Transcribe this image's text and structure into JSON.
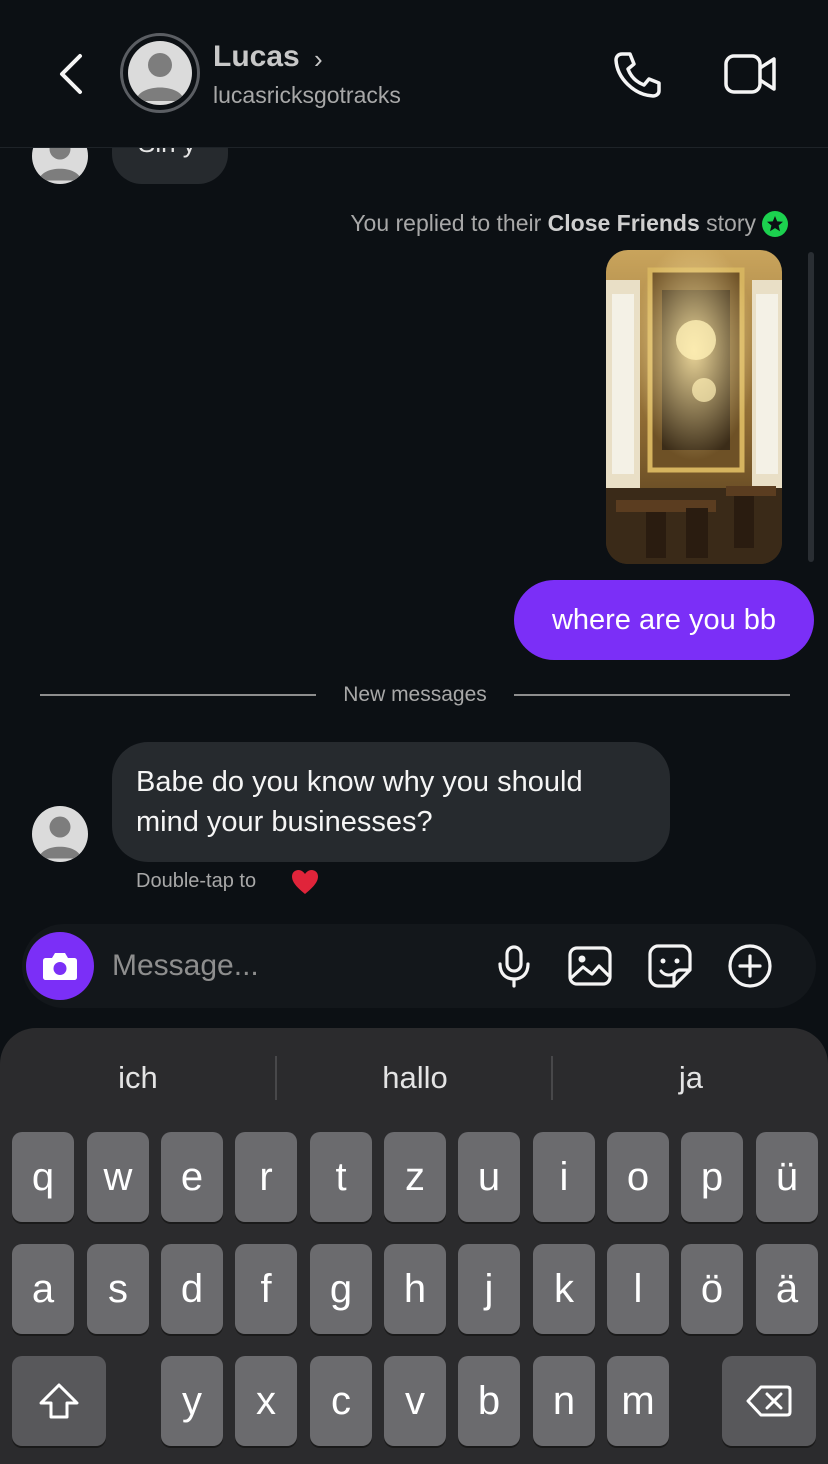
{
  "header": {
    "name": "Lucas",
    "username": "lucasricksgotracks",
    "chevron": "›"
  },
  "chat": {
    "partial_message": "Sin y",
    "story_note_prefix": "You replied to their ",
    "story_note_bold": "Close Friends",
    "story_note_suffix": " story",
    "sent_message": "where are you bb",
    "divider_label": "New messages",
    "received_message": "Babe do you know why you should mind your businesses?",
    "double_tap_hint": "Double-tap to"
  },
  "composer": {
    "placeholder": "Message..."
  },
  "keyboard": {
    "suggestions": [
      "ich",
      "hallo",
      "ja"
    ],
    "row1": [
      "q",
      "w",
      "e",
      "r",
      "t",
      "z",
      "u",
      "i",
      "o",
      "p",
      "ü"
    ],
    "row2": [
      "a",
      "s",
      "d",
      "f",
      "g",
      "h",
      "j",
      "k",
      "l",
      "ö",
      "ä"
    ],
    "row3": [
      "y",
      "x",
      "c",
      "v",
      "b",
      "n",
      "m"
    ]
  },
  "colors": {
    "accent": "#7b2ff7",
    "close_friends": "#1cd14f",
    "background": "#0c1014",
    "bubble_received": "#262a2e"
  }
}
